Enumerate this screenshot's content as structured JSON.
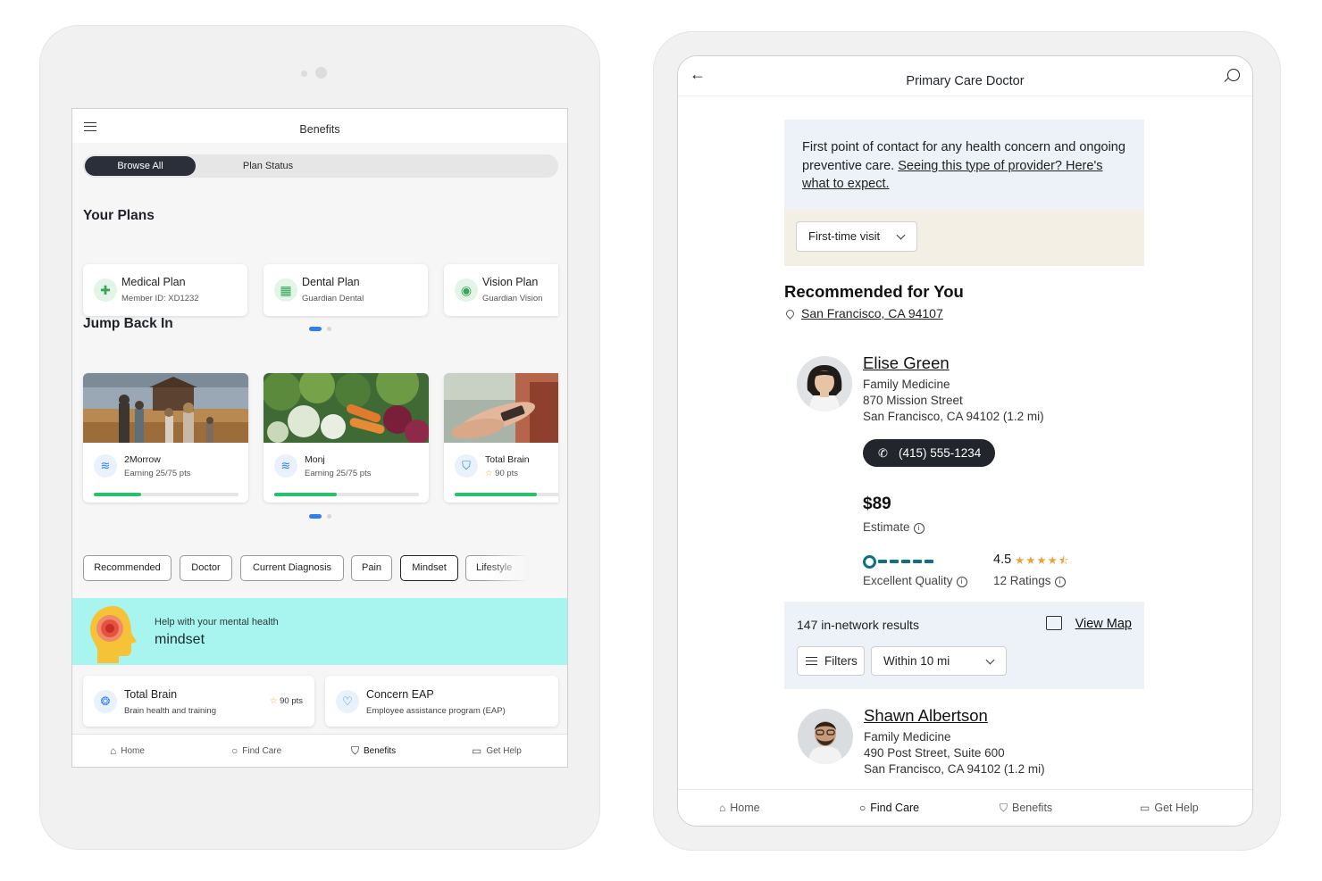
{
  "left_app": {
    "header_title": "Benefits",
    "tabs": [
      {
        "label": "Browse All",
        "active": true
      },
      {
        "label": "Plan Status",
        "active": false
      }
    ],
    "your_plans": {
      "title": "Your Plans",
      "cards": [
        {
          "name": "Medical Plan",
          "subtitle": "Member ID: XD1232",
          "icon": "medical-cross-icon"
        },
        {
          "name": "Dental Plan",
          "subtitle": "Guardian Dental",
          "icon": "dental-icon"
        },
        {
          "name": "Vision Plan",
          "subtitle": "Guardian Vision",
          "icon": "eye-icon"
        }
      ]
    },
    "jump_back_in": {
      "title": "Jump Back In",
      "cards": [
        {
          "name": "2Morrow",
          "subtitle": "Earning 25/75 pts",
          "progress": 0.33,
          "icon": "program-icon"
        },
        {
          "name": "Monj",
          "subtitle": "Earning 25/75 pts",
          "progress": 0.43,
          "icon": "program-icon"
        },
        {
          "name": "Total Brain",
          "subtitle": "90 pts",
          "progress": 0.57,
          "icon": "shield-icon"
        }
      ]
    },
    "filter_chips": [
      {
        "label": "Recommended",
        "selected": false
      },
      {
        "label": "Doctor",
        "selected": false
      },
      {
        "label": "Current Diagnosis",
        "selected": false
      },
      {
        "label": "Pain",
        "selected": false
      },
      {
        "label": "Mindset",
        "selected": true
      },
      {
        "label": "Lifestyle",
        "selected": false
      }
    ],
    "banner": {
      "subtitle": "Help with your mental health",
      "title": "mindset",
      "background": "#a8f5f0"
    },
    "programs": [
      {
        "name": "Total Brain",
        "subtitle": "Brain health and training",
        "points": "90 pts"
      },
      {
        "name": "Concern EAP",
        "subtitle": "Employee assistance program (EAP)",
        "points": ""
      }
    ],
    "bottom_nav": [
      {
        "label": "Home",
        "icon": "home-icon",
        "active": false
      },
      {
        "label": "Find Care",
        "icon": "search-icon",
        "active": false
      },
      {
        "label": "Benefits",
        "icon": "shield-icon",
        "active": true
      },
      {
        "label": "Get Help",
        "icon": "chat-icon",
        "active": false
      }
    ]
  },
  "right_app": {
    "header_title": "Primary Care Doctor",
    "info": {
      "text": "First point of contact for any health concern and ongoing preventive care.",
      "link": "Seeing this type of provider? Here's what to expect."
    },
    "visit_type": "First-time visit",
    "recommended": {
      "title": "Recommended for You",
      "location": "San Francisco, CA 94107"
    },
    "doctors": [
      {
        "name": "Elise Green",
        "specialty": "Family Medicine",
        "address1": "870 Mission Street",
        "address2": "San Francisco, CA 94102 (1.2 mi)",
        "phone": "(415) 555-1234",
        "price": "$89",
        "price_label": "Estimate",
        "quality_label": "Excellent Quality",
        "rating": "4.5",
        "ratings_count": "12 Ratings"
      },
      {
        "name": "Shawn Albertson",
        "specialty": "Family Medicine",
        "address1": "490 Post Street, Suite 600",
        "address2": "San Francisco, CA 94102 (1.2 mi)"
      }
    ],
    "results": {
      "count_text": "147 in-network results",
      "view_map": "View Map",
      "filters_label": "Filters",
      "distance": "Within 10 mi"
    },
    "bottom_nav": [
      {
        "label": "Home",
        "icon": "home-icon",
        "active": false
      },
      {
        "label": "Find Care",
        "icon": "search-icon",
        "active": true
      },
      {
        "label": "Benefits",
        "icon": "shield-icon",
        "active": false
      },
      {
        "label": "Get Help",
        "icon": "chat-icon",
        "active": false
      }
    ]
  },
  "colors": {
    "accent_blue": "#2f80ed",
    "progress_green": "#27c26a",
    "dark_button": "#22252b",
    "star_orange": "#e8a33c",
    "quality_teal": "#0e6f85"
  }
}
